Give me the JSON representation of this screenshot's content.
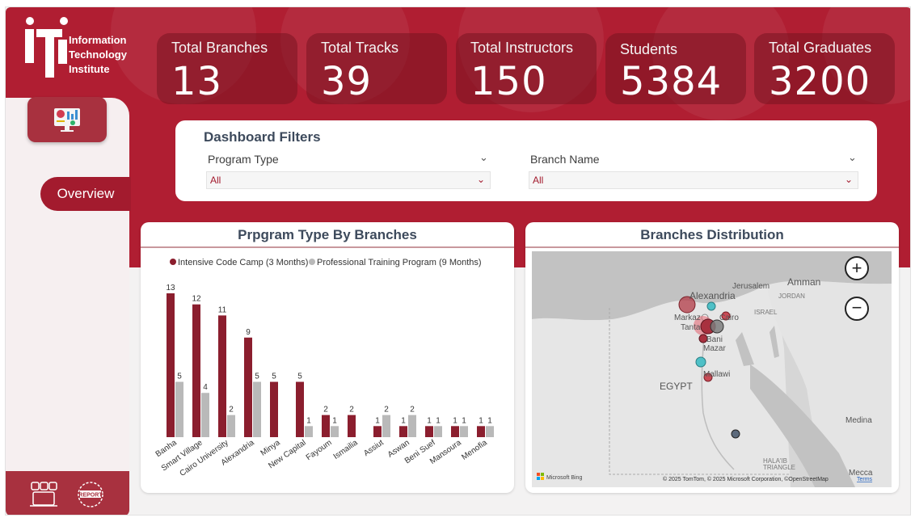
{
  "logo": {
    "line1": "Information",
    "line2": "Technology",
    "line3": "Institute"
  },
  "nav": {
    "overview_label": "Overview"
  },
  "kpis": [
    {
      "label": "Total Branches",
      "value": "13"
    },
    {
      "label": "Total Tracks",
      "value": "39"
    },
    {
      "label": "Total Instructors",
      "value": "150"
    },
    {
      "label": "Students",
      "value": "5384"
    },
    {
      "label": "Total Graduates",
      "value": "3200"
    }
  ],
  "filters": {
    "title": "Dashboard Filters",
    "program_type": {
      "label": "Program Type",
      "value": "All"
    },
    "branch_name": {
      "label": "Branch Name",
      "value": "All"
    }
  },
  "bar_card": {
    "title": "Prpgram Type By Branches"
  },
  "map_card": {
    "title": "Branches Distribution",
    "labels": [
      "Alexandria",
      "Jerusalem",
      "Amman",
      "ISRAEL",
      "JORDAN",
      "Markaz",
      "Cairo",
      "Tanta",
      "Bani",
      "Mazar",
      "Mallawi",
      "EGYPT",
      "Medina",
      "HALA'IB",
      "TRIANGLE",
      "Mecca"
    ],
    "attribution": "© 2025 TomTom, © 2025 Microsoft Corporation, ©OpenStreetMap",
    "terms": "Terms",
    "provider": "Microsoft Bing"
  },
  "chart_data": {
    "type": "bar",
    "categories": [
      "Banha",
      "Smart Village",
      "Cairo University",
      "Alexandria",
      "Minya",
      "New Capital",
      "Fayoum",
      "Ismailia",
      "Assiut",
      "Aswan",
      "Beni Suef",
      "Mansoura",
      "Menofia"
    ],
    "series": [
      {
        "name": "Intensive Code Camp (3 Months)",
        "values": [
          13,
          12,
          11,
          9,
          5,
          5,
          2,
          2,
          null,
          null,
          1,
          1,
          1
        ]
      },
      {
        "name": "Professional Training Program (9 Months)",
        "values": [
          5,
          4,
          2,
          5,
          null,
          1,
          1,
          null,
          2,
          2,
          1,
          1,
          1
        ]
      }
    ],
    "colors": [
      "#8b1e2e",
      "#b9b9b9"
    ],
    "ylim": [
      0,
      13
    ],
    "legend": "top"
  },
  "assiut_aswan_ict": {
    "Assiut": 1,
    "Aswan": 1
  }
}
